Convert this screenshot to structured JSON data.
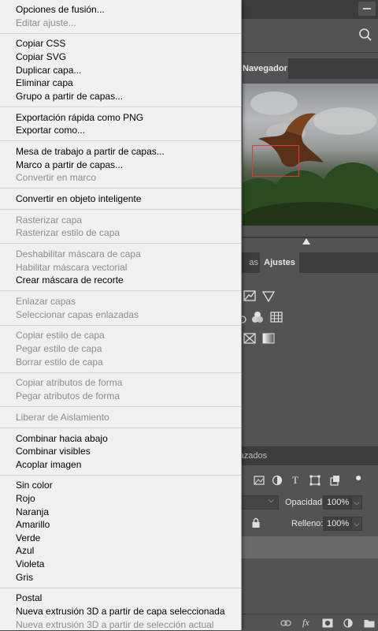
{
  "menu": {
    "groups": [
      [
        {
          "label": "Opciones de fusión...",
          "enabled": true
        },
        {
          "label": "Editar ajuste...",
          "enabled": false
        }
      ],
      [
        {
          "label": "Copiar CSS",
          "enabled": true
        },
        {
          "label": "Copiar SVG",
          "enabled": true
        },
        {
          "label": "Duplicar capa...",
          "enabled": true
        },
        {
          "label": "Eliminar capa",
          "enabled": true
        },
        {
          "label": "Grupo a partir de capas...",
          "enabled": true
        }
      ],
      [
        {
          "label": "Exportación rápida como PNG",
          "enabled": true
        },
        {
          "label": "Exportar como...",
          "enabled": true
        }
      ],
      [
        {
          "label": "Mesa de trabajo a partir de capas...",
          "enabled": true
        },
        {
          "label": "Marco a partir de capas...",
          "enabled": true
        },
        {
          "label": "Convertir en marco",
          "enabled": false
        }
      ],
      [
        {
          "label": "Convertir en objeto inteligente",
          "enabled": true
        }
      ],
      [
        {
          "label": "Rasterizar capa",
          "enabled": false
        },
        {
          "label": "Rasterizar estilo de capa",
          "enabled": false
        }
      ],
      [
        {
          "label": "Deshabilitar máscara de capa",
          "enabled": false
        },
        {
          "label": "Habilitar máscara vectorial",
          "enabled": false
        },
        {
          "label": "Crear máscara de recorte",
          "enabled": true
        }
      ],
      [
        {
          "label": "Enlazar capas",
          "enabled": false
        },
        {
          "label": "Seleccionar capas enlazadas",
          "enabled": false
        }
      ],
      [
        {
          "label": "Copiar estilo de capa",
          "enabled": false
        },
        {
          "label": "Pegar estilo de capa",
          "enabled": false
        },
        {
          "label": "Borrar estilo de capa",
          "enabled": false
        }
      ],
      [
        {
          "label": "Copiar atributos de forma",
          "enabled": false
        },
        {
          "label": "Pegar atributos de forma",
          "enabled": false
        }
      ],
      [
        {
          "label": "Liberar de Aislamiento",
          "enabled": false
        }
      ],
      [
        {
          "label": "Combinar hacia abajo",
          "enabled": true
        },
        {
          "label": "Combinar visibles",
          "enabled": true
        },
        {
          "label": "Acoplar imagen",
          "enabled": true
        }
      ],
      [
        {
          "label": "Sin color",
          "enabled": true
        },
        {
          "label": "Rojo",
          "enabled": true
        },
        {
          "label": "Naranja",
          "enabled": true
        },
        {
          "label": "Amarillo",
          "enabled": true
        },
        {
          "label": "Verde",
          "enabled": true
        },
        {
          "label": "Azul",
          "enabled": true
        },
        {
          "label": "Violeta",
          "enabled": true
        },
        {
          "label": "Gris",
          "enabled": true
        }
      ],
      [
        {
          "label": "Postal",
          "enabled": true
        },
        {
          "label": "Nueva extrusión 3D a partir de capa seleccionada",
          "enabled": true
        },
        {
          "label": "Nueva extrusión 3D a partir de selección actual",
          "enabled": false
        }
      ]
    ]
  },
  "panels": {
    "navigator_tab": "Navegador",
    "adjustments_tab_partial": "as",
    "adjustments_tab": "Ajustes",
    "layers_tab_partial": "razados",
    "opacity_label": "Opacidad:",
    "opacity_value": "100%",
    "fill_label": "Relleno:",
    "fill_value": "100%"
  },
  "colors": {
    "menu_bg": "#f0f0f0",
    "disabled_text": "#8c8c8c",
    "panel_bg": "#535353",
    "navigator_frame": "#e23a3a"
  }
}
